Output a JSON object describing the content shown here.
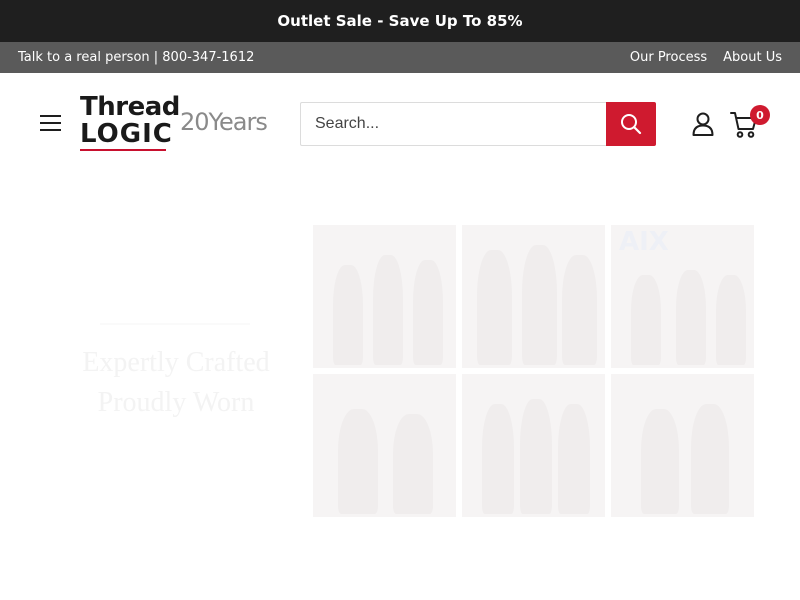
{
  "promo": {
    "text": "Outlet Sale - Save Up To 85%"
  },
  "utility": {
    "contact": "Talk to a real person | 800-347-1612",
    "links": [
      "Our Process",
      "About Us"
    ]
  },
  "header": {
    "logo": {
      "line1": "Thread",
      "line2": "LOGIC",
      "years": "20Years"
    },
    "search": {
      "placeholder": "Search..."
    },
    "cart_count": "0"
  },
  "hero": {
    "heading_line1": "Expertly Crafted",
    "heading_line2": "Proudly Worn",
    "tile_text": "AIX"
  },
  "colors": {
    "accent": "#cf1a2f",
    "promo_bg": "#1f1f1f",
    "utility_bg": "#5a5a5a"
  },
  "icons": [
    "menu-icon",
    "search-icon",
    "account-icon",
    "cart-icon"
  ]
}
